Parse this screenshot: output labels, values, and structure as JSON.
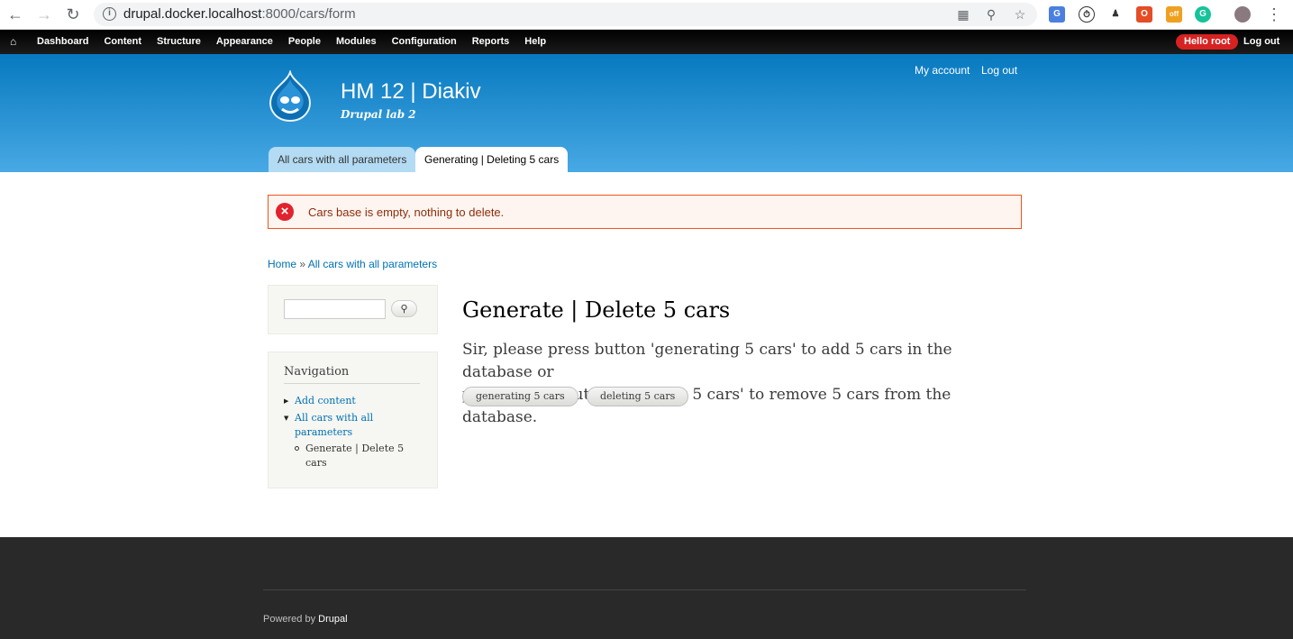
{
  "browser": {
    "url_host": "drupal.docker.localhost",
    "url_path": ":8000/cars/form"
  },
  "toolbar": {
    "items": [
      "Dashboard",
      "Content",
      "Structure",
      "Appearance",
      "People",
      "Modules",
      "Configuration",
      "Reports",
      "Help"
    ],
    "hello": "Hello root",
    "logout": "Log out"
  },
  "header": {
    "site_name": "HM 12 | Diakiv",
    "slogan": "Drupal lab 2",
    "my_account": "My account",
    "log_out": "Log out",
    "tabs": [
      "All cars with all parameters",
      "Generating | Deleting 5 cars"
    ]
  },
  "message": {
    "text": "Cars base is empty, nothing to delete."
  },
  "breadcrumb": {
    "home": "Home",
    "separator": "»",
    "current": "All cars with all parameters"
  },
  "sidebar": {
    "navigation_title": "Navigation",
    "items": [
      {
        "label": "Add content"
      },
      {
        "label_line1": "All cars with all",
        "label_line2": "parameters"
      }
    ],
    "subitem_line1": "Generate | Delete 5",
    "subitem_line2": "cars"
  },
  "main": {
    "title": "Generate | Delete 5 cars",
    "text_line1": "Sir, please press button 'generating 5 cars' to add 5 cars in the database or",
    "text_line2": "please press button 'deleting 5 cars' to remove 5 cars from the database.",
    "generate_button": "generating 5 cars",
    "delete_button": "deleting 5 cars"
  },
  "footer": {
    "powered_by": "Powered by",
    "drupal": "Drupal"
  },
  "colors": {
    "toolbar": "#000000",
    "header_top": "#0779bf",
    "header_bottom": "#48a9e4",
    "error_border": "#ed541d",
    "error_text": "#8c2e0b",
    "link": "#0071b3",
    "hello_badge": "#d72222",
    "footer": "#292929"
  }
}
